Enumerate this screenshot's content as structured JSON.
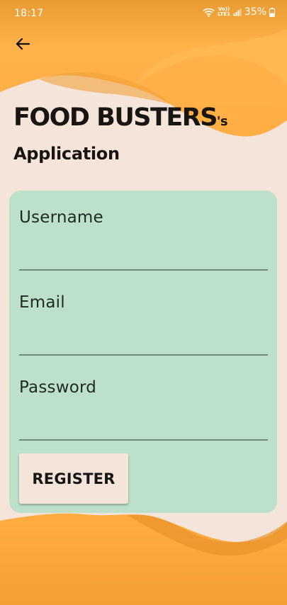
{
  "status_bar": {
    "time": "18:17",
    "network_label": "VoLTE1",
    "network_line1": "Vo))",
    "network_line2": "LTE1",
    "battery_percent": "35%",
    "icons": [
      "wifi-icon",
      "signal-icon",
      "battery-icon"
    ]
  },
  "header": {
    "back_icon": "arrow-left-icon",
    "title_brand": "FOOD BUSTERS",
    "title_suffix": "'s",
    "subtitle": "Application"
  },
  "form": {
    "fields": [
      {
        "label": "Username",
        "value": "",
        "placeholder": ""
      },
      {
        "label": "Email",
        "value": "",
        "placeholder": ""
      },
      {
        "label": "Password",
        "value": "",
        "placeholder": ""
      }
    ],
    "register_label": "REGISTER"
  },
  "colors": {
    "background": "#f5e4da",
    "wave_orange": "#ffb24a",
    "card": "#bde0ca",
    "text_dark": "#181512"
  }
}
